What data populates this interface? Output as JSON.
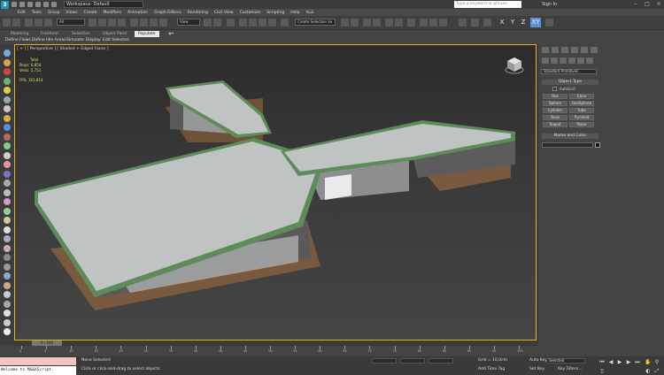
{
  "titlebar": {
    "workspace": "Workspace: Default",
    "search_placeholder": "Type a keyword or phrase",
    "signin": "Sign In"
  },
  "menu": [
    "Edit",
    "Tools",
    "Group",
    "Views",
    "Create",
    "Modifiers",
    "Animation",
    "Graph Editors",
    "Rendering",
    "Civil View",
    "Customize",
    "Scripting",
    "Help",
    "Vu3"
  ],
  "toolbar": {
    "selection_set": "All",
    "view_dropdown": "View",
    "named_selection": "Create Selection Se",
    "axis_x": "X",
    "axis_y": "Y",
    "axis_z": "Z",
    "axis_xy": "XY"
  },
  "ribbon": {
    "tabs": [
      "Modeling",
      "Freeform",
      "Selection",
      "Object Paint",
      "Populate"
    ],
    "items": [
      "Define Flows",
      "Define Idle Areas",
      "Simulate",
      "Display",
      "Edit Selected"
    ]
  },
  "viewport": {
    "label": "[ + ] [ Perspective ] [ Shaded + Edged Faces ]",
    "stats_total": "Total",
    "stats_polys_label": "Polys:",
    "stats_polys": "6,854",
    "stats_verts_label": "Verts:",
    "stats_verts": "5,751",
    "stats_fps_label": "FPS:",
    "stats_fps": "161.814"
  },
  "command_panel": {
    "category_dropdown": "Standard Primitives",
    "object_type_header": "Object Type",
    "autogrid_label": "AutoGrid",
    "buttons": [
      "Box",
      "Cone",
      "Sphere",
      "GeoSphere",
      "Cylinder",
      "Tube",
      "Torus",
      "Pyramid",
      "Teapot",
      "Plane"
    ],
    "name_color_header": "Name and Color"
  },
  "timeline": {
    "slider": "0 / 100",
    "ticks": [
      "0",
      "5",
      "10",
      "15",
      "20",
      "25",
      "30",
      "35",
      "40",
      "45",
      "50",
      "55",
      "60",
      "65",
      "70",
      "75",
      "80",
      "85",
      "90",
      "95",
      "100"
    ]
  },
  "status": {
    "maxscript_output": "Welcome to M&&XScript.",
    "selection_status": "None Selected",
    "prompt": "Click or click-and-drag to select objects",
    "grid": "Grid = 10,0cm",
    "add_time_tag": "Add Time Tag",
    "auto_key": "Auto Key",
    "set_key": "Set Key",
    "key_mode": "Selected",
    "key_filters": "Key Filters..."
  },
  "colors": {
    "viewport_border": "#e6b020",
    "roof": "#bfc3c2",
    "roof_trim": "#5d8c5a",
    "floor": "#8b5e3c",
    "active_axis": "#5b8fd6"
  }
}
